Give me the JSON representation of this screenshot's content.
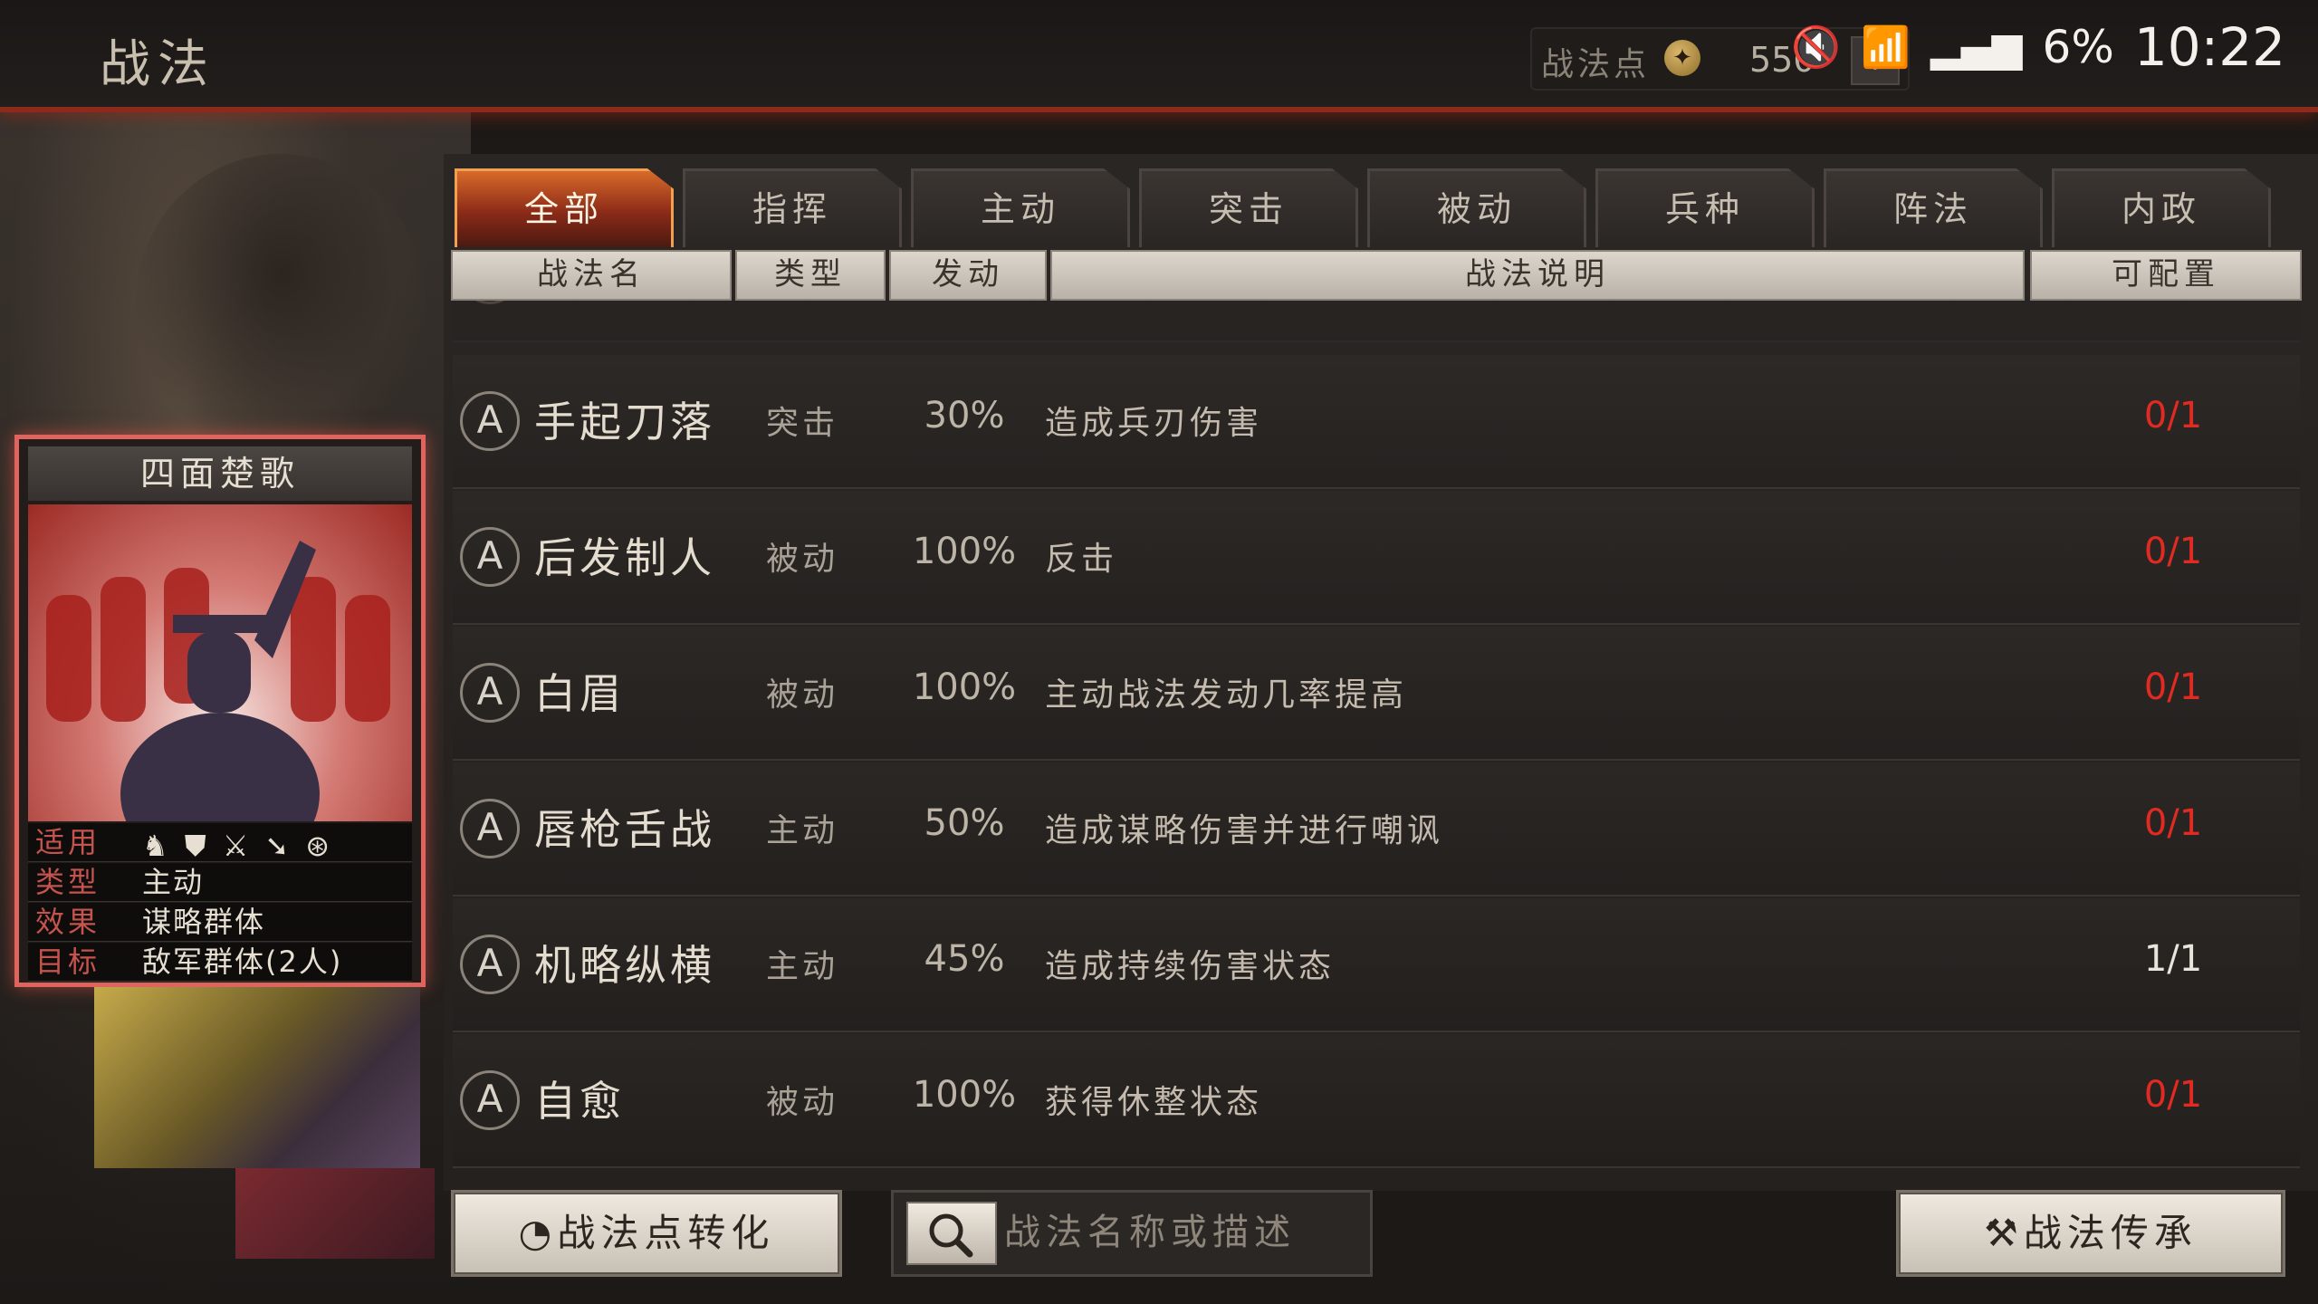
{
  "header": {
    "title": "战法",
    "points_label": "战法点",
    "points_value": "550",
    "points_add": "+"
  },
  "status_bar": {
    "battery": "6%",
    "time": "10:22"
  },
  "tabs": [
    "全部",
    "指挥",
    "主动",
    "突击",
    "被动",
    "兵种",
    "阵法",
    "内政"
  ],
  "active_tab": "全部",
  "columns": [
    "战法名",
    "类型",
    "发动",
    "战法说明",
    "可配置"
  ],
  "rows": [
    {
      "grade": "A",
      "name": "手起刀落",
      "type": "突击",
      "rate": "30%",
      "desc": "造成兵刃伤害",
      "count": "0/1"
    },
    {
      "grade": "A",
      "name": "后发制人",
      "type": "被动",
      "rate": "100%",
      "desc": "反击",
      "count": "0/1"
    },
    {
      "grade": "A",
      "name": "白眉",
      "type": "被动",
      "rate": "100%",
      "desc": "主动战法发动几率提高",
      "count": "0/1"
    },
    {
      "grade": "A",
      "name": "唇枪舌战",
      "type": "主动",
      "rate": "50%",
      "desc": "造成谋略伤害并进行嘲讽",
      "count": "0/1"
    },
    {
      "grade": "A",
      "name": "机略纵横",
      "type": "主动",
      "rate": "45%",
      "desc": "造成持续伤害状态",
      "count": "1/1"
    },
    {
      "grade": "A",
      "name": "自愈",
      "type": "被动",
      "rate": "100%",
      "desc": "获得休整状态",
      "count": "0/1"
    }
  ],
  "card": {
    "title": "四面楚歌",
    "label_apply": "适用",
    "label_type": "类型",
    "value_type": "主动",
    "label_effect": "效果",
    "value_effect": "谋略群体",
    "label_target": "目标",
    "value_target": "敌军群体(2人)"
  },
  "bottom": {
    "convert_button": "战法点转化",
    "search_placeholder": "战法名称或描述",
    "inherit_button": "战法传承"
  },
  "colors": {
    "accent_red": "#e02a22",
    "tab_active": "#d86a2a"
  }
}
